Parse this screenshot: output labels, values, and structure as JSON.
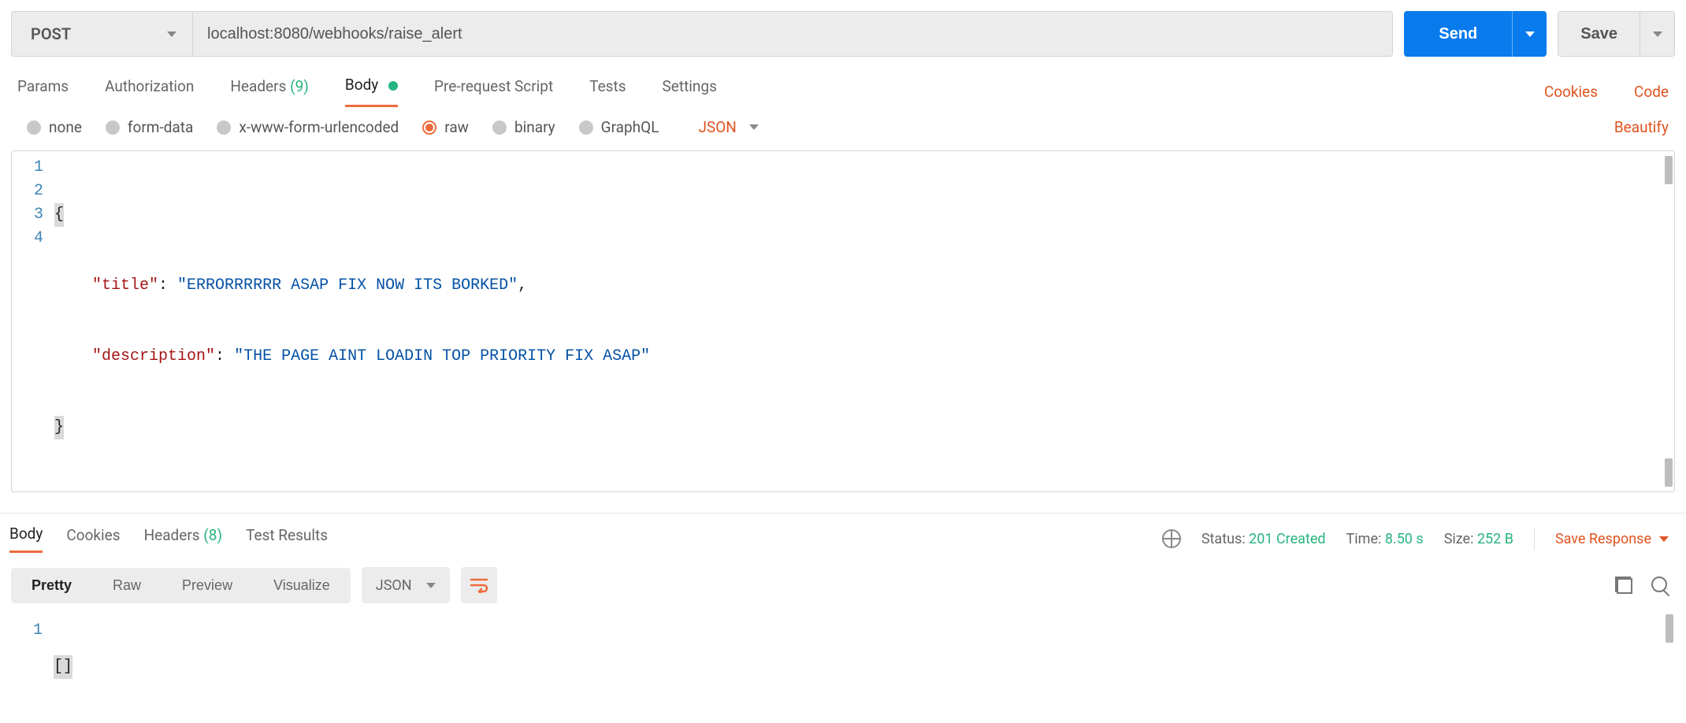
{
  "request": {
    "method": "POST",
    "url": "localhost:8080/webhooks/raise_alert",
    "send_label": "Send",
    "save_label": "Save"
  },
  "request_tabs": {
    "params": "Params",
    "authorization": "Authorization",
    "headers_label": "Headers",
    "headers_count": "(9)",
    "body": "Body",
    "prerequest": "Pre-request Script",
    "tests": "Tests",
    "settings": "Settings",
    "cookies_link": "Cookies",
    "code_link": "Code"
  },
  "body_options": {
    "none": "none",
    "formdata": "form-data",
    "xwww": "x-www-form-urlencoded",
    "raw": "raw",
    "binary": "binary",
    "graphql": "GraphQL",
    "type": "JSON",
    "beautify": "Beautify"
  },
  "request_body": {
    "lines": [
      "1",
      "2",
      "3",
      "4"
    ],
    "l1_open": "{",
    "l2_key": "\"title\"",
    "l2_colon": ": ",
    "l2_val": "\"ERRORRRRRR ASAP FIX NOW ITS BORKED\"",
    "l2_comma": ",",
    "l3_key": "\"description\"",
    "l3_colon": ": ",
    "l3_val": "\"THE PAGE AINT LOADIN TOP PRIORITY FIX ASAP\"",
    "l4_close": "}"
  },
  "response_tabs": {
    "body": "Body",
    "cookies": "Cookies",
    "headers_label": "Headers",
    "headers_count": "(8)",
    "test_results": "Test Results"
  },
  "response_meta": {
    "status_label": "Status:",
    "status_value": "201 Created",
    "time_label": "Time:",
    "time_value": "8.50 s",
    "size_label": "Size:",
    "size_value": "252 B",
    "save_response": "Save Response"
  },
  "response_toolbar": {
    "pretty": "Pretty",
    "raw": "Raw",
    "preview": "Preview",
    "visualize": "Visualize",
    "format": "JSON"
  },
  "response_body": {
    "line_number": "1",
    "content": "[]"
  }
}
